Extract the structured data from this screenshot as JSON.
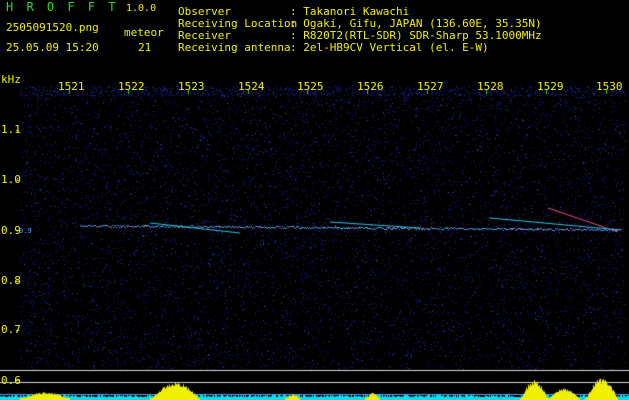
{
  "header": {
    "app_name": "H R O F F T",
    "version": "1.0.0",
    "filename": "2505091520.png",
    "datetime": "25.05.09 15:20",
    "meteor_label": "meteor",
    "meteor_count": "21",
    "fields": [
      {
        "label": "Observer",
        "value": ": Takanori Kawachi"
      },
      {
        "label": "Receiving Location",
        "value": ": Ogaki, Gifu, JAPAN (136.60E, 35.35N)"
      },
      {
        "label": "Receiver",
        "value": ": R820T2(RTL-SDR) SDR-Sharp 53.1000MHz"
      },
      {
        "label": "Receiving antenna",
        "value": ": 2el-HB9CV Vertical (el. E-W)"
      }
    ]
  },
  "axis": {
    "unit": "kHz",
    "x_ticks": [
      "1521",
      "1522",
      "1523",
      "1524",
      "1525",
      "1526",
      "1527",
      "1528",
      "1529",
      "1530"
    ],
    "y_ticks": [
      "1.1",
      "1.0",
      "0.9",
      "0.8",
      "0.7",
      "0.6"
    ],
    "y_side_label": "0.9"
  },
  "colors": {
    "background": "#000000",
    "noise": "#1a1f8c",
    "echo": "#30c0e0",
    "yellow": "#f0f000",
    "green": "#20e020",
    "cyan": "#00e0f0"
  }
}
